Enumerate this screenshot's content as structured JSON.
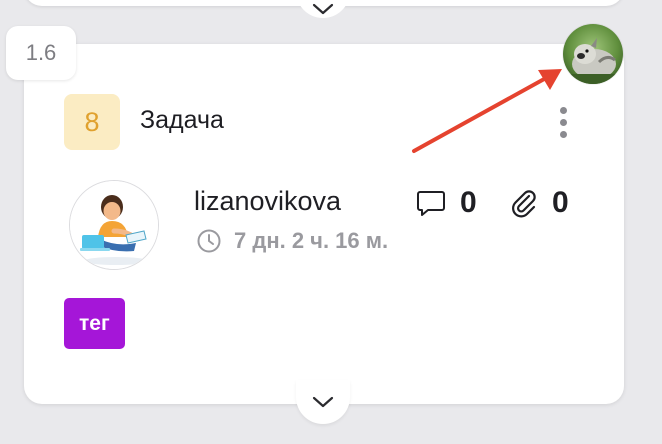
{
  "task": {
    "index_label": "1.6",
    "priority": "8",
    "type_label": "Задача",
    "assignee": {
      "username": "lizanovikova"
    },
    "timer_text": "7 дн. 2 ч. 16 м.",
    "comments_count": "0",
    "attachments_count": "0",
    "tag_label": "тег"
  },
  "icons": {
    "expand_top": "chevron-down-icon",
    "expand_bottom": "chevron-down-icon",
    "more": "more-vertical-icon",
    "clock": "clock-icon",
    "comment": "comment-icon",
    "attachment": "paperclip-icon"
  },
  "colors": {
    "priority_bg": "#fbecc3",
    "priority_text": "#e0a12e",
    "tag_bg": "#a516d8",
    "annotation_arrow": "#e5432f"
  }
}
